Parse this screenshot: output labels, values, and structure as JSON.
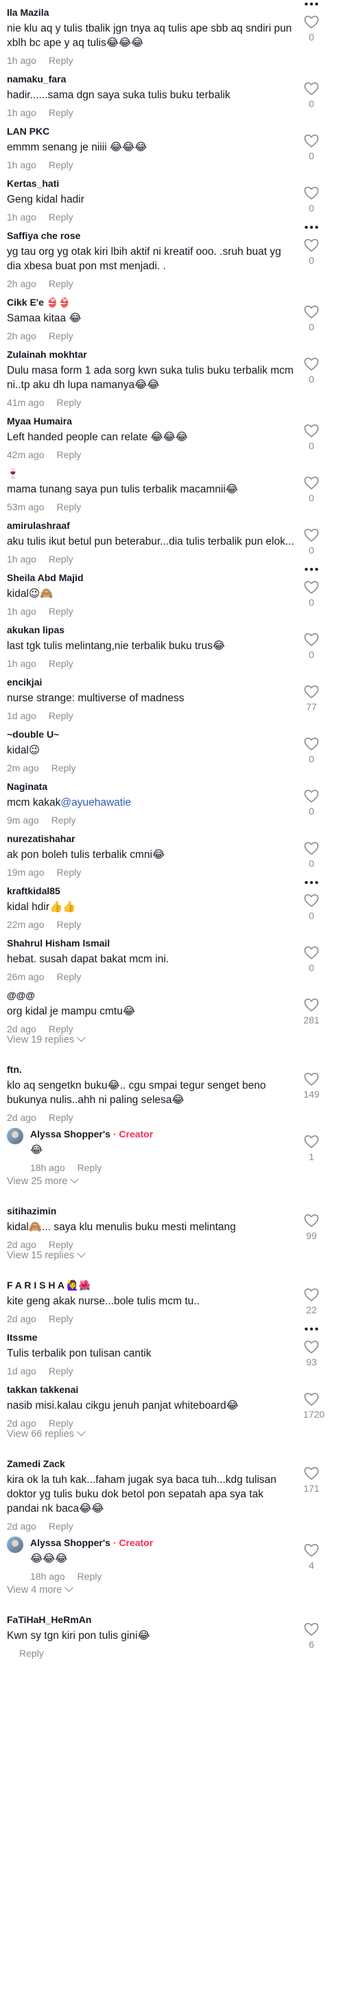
{
  "ui": {
    "reply_label": "Reply",
    "creator_label": "Creator",
    "heart_icon": "heart-outline-icon",
    "more_icon": "more-dots-icon",
    "colors": {
      "accent": "#fe2c55",
      "mention": "#2b5db9",
      "muted": "#8a8b91"
    }
  },
  "comments": [
    {
      "user": "Ila Mazila",
      "text": "nie klu aq y tulis tbalik jgn tnya aq tulis ape sbb aq sndiri pun xblh bc ape y aq tulis😂😂😂",
      "time": "1h ago",
      "likes": "0",
      "more": true
    },
    {
      "user": "namaku_fara",
      "text": "hadir......sama dgn saya suka tulis buku terbalik",
      "time": "1h ago",
      "likes": "0"
    },
    {
      "user": "LAN PKC",
      "text": "emmm senang je niiii 😂😂😂",
      "time": "1h ago",
      "likes": "0"
    },
    {
      "user": "Kertas_hati",
      "text": "Geng kidal hadir",
      "time": "1h ago",
      "likes": "0"
    },
    {
      "user": "Saffiya che rose",
      "text": "yg tau org yg otak kiri lbih aktif ni kreatif ooo. .sruh buat yg dia xbesa buat pon mst menjadi. .",
      "time": "2h ago",
      "likes": "0",
      "more": true
    },
    {
      "user": "Cikk E'e 👙👙",
      "text": "Samaa kitaa 😂",
      "time": "2h ago",
      "likes": "0"
    },
    {
      "user": "Zulainah mokhtar",
      "text": "Dulu masa form 1 ada sorg kwn suka tulis buku terbalik mcm ni..tp aku dh lupa namanya😂😂",
      "time": "41m ago",
      "likes": "0"
    },
    {
      "user": "Myaa Humaira",
      "text": "Left handed people can relate 😂😂😂",
      "time": "42m ago",
      "likes": "0"
    },
    {
      "user": "🍷",
      "text": "mama tunang saya pun tulis terbalik macamnii😂",
      "time": "53m ago",
      "likes": "0"
    },
    {
      "user": "amirulashraaf",
      "text": "aku tulis ikut betul pun beterabur...dia tulis terbalik pun elok...",
      "time": "1h ago",
      "likes": "0"
    },
    {
      "user": "Sheila Abd Majid",
      "text": "kidal😉🙈",
      "time": "1h ago",
      "likes": "0",
      "more": true
    },
    {
      "user": "akukan lipas",
      "text": "last tgk tulis melintang,nie terbalik buku trus😂",
      "time": "1h ago",
      "likes": "0"
    },
    {
      "user": "encikjai",
      "text": "nurse strange: multiverse of madness",
      "time": "1d ago",
      "likes": "77"
    },
    {
      "user": "~double U~",
      "text": "kidal😉",
      "time": "2m ago",
      "likes": "0"
    },
    {
      "user": "Naginata",
      "text": "mcm kakak",
      "mention": "@ayuehawatie",
      "time": "9m ago",
      "likes": "0"
    },
    {
      "user": "nurezatishahar",
      "text": "ak pon boleh tulis terbalik cmni😂",
      "time": "19m ago",
      "likes": "0"
    },
    {
      "user": "kraftkidal85",
      "text": "kidal hdir👍👍",
      "time": "22m ago",
      "likes": "0",
      "more": true
    },
    {
      "user": "Shahrul Hisham Ismail",
      "text": "hebat. susah dapat bakat mcm ini.",
      "time": "26m ago",
      "likes": "0"
    },
    {
      "user": "@@@",
      "text": "org kidal je mampu cmtu😂",
      "time": "2d ago",
      "likes": "281",
      "view_replies": "View 19 replies"
    },
    {
      "user": "ftn.",
      "text": "klo aq sengetkn buku😂.. cgu smpai tegur senget beno bukunya nulis..ahh ni paling selesa😂",
      "time": "2d ago",
      "likes": "149",
      "replies": [
        {
          "user": "Alyssa Shopper's",
          "creator": true,
          "text": "😂",
          "time": "18h ago",
          "likes": "1"
        }
      ],
      "view_replies": "View 25 more"
    },
    {
      "user": "sitihazimin",
      "text": "kidal🙈... saya klu menulis buku mesti melintang",
      "time": "2d ago",
      "likes": "99",
      "view_replies": "View 15 replies"
    },
    {
      "user": "F A R I S H A 🙋‍♀️🌺",
      "text": "kite geng akak nurse...bole tulis mcm tu..",
      "time": "2d ago",
      "likes": "22"
    },
    {
      "user": "Itssme",
      "text": "Tulis terbalik pon tulisan cantik",
      "time": "1d ago",
      "likes": "93",
      "more": true
    },
    {
      "user": "takkan takkenai",
      "text": "nasib misi.kalau cikgu jenuh panjat whiteboard😂",
      "time": "2d ago",
      "likes": "1720",
      "view_replies": "View 66 replies"
    },
    {
      "user": "Zamedi Zack",
      "text": "kira ok la tuh kak...faham jugak sya baca tuh...kdg tulisan doktor yg tulis buku dok betol pon sepatah apa sya tak pandai nk baca😂😂",
      "time": "2d ago",
      "likes": "171",
      "replies": [
        {
          "user": "Alyssa Shopper's",
          "creator": true,
          "text": "😂😂😂",
          "time": "18h ago",
          "likes": "4"
        }
      ],
      "view_replies": "View 4 more"
    },
    {
      "user": "FaTiHaH_HeRmAn",
      "text": "Kwn sy tgn kiri pon tulis gini😂",
      "time": "",
      "likes": "6"
    }
  ]
}
